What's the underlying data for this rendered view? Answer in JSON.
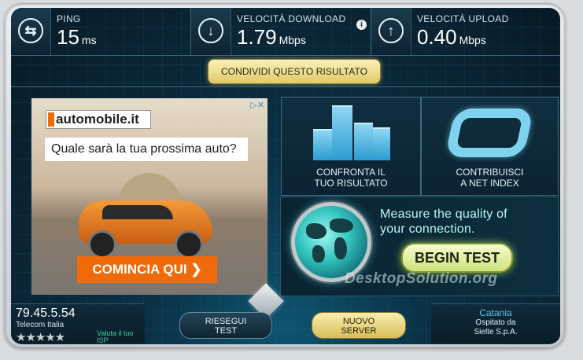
{
  "metrics": {
    "ping": {
      "label": "PING",
      "value": "15",
      "unit": "ms"
    },
    "download": {
      "label": "VELOCITÀ DOWNLOAD",
      "value": "1.79",
      "unit": "Mbps"
    },
    "upload": {
      "label": "VELOCITÀ UPLOAD",
      "value": "0.40",
      "unit": "Mbps"
    }
  },
  "share_button": "CONDIVIDI QUESTO RISULTATO",
  "ad": {
    "brand": "automobile.it",
    "question": "Quale sarà la tua prossima auto?",
    "cta": "COMINCIA QUI ❯"
  },
  "tiles": {
    "compare": {
      "line1": "CONFRONTA IL",
      "line2": "TUO RISULTATO"
    },
    "contribute": {
      "line1": "CONTRIBUISCI",
      "line2": "A NET INDEX"
    }
  },
  "promo": {
    "line1": "Measure the quality of",
    "line2": "your connection.",
    "begin": "BEGIN TEST"
  },
  "watermark": "DesktopSolution.org",
  "client": {
    "ip": "79.45.5.54",
    "isp": "Telecom Italia",
    "rate_line1": "Valuta il tuo",
    "rate_line2": "ISP",
    "stars": 0
  },
  "buttons": {
    "rerun_line1": "RIESEGUI",
    "rerun_line2": "TEST",
    "new_line1": "NUOVO",
    "new_line2": "SERVER"
  },
  "server": {
    "city": "Catania",
    "host_line1": "Ospitato da",
    "host_line2": "Sielte S.p.A."
  },
  "colors": {
    "accent": "#5ac8ea",
    "gold": "#e0c968",
    "cta": "#f06a0a",
    "promo": "#b8f7ee"
  }
}
